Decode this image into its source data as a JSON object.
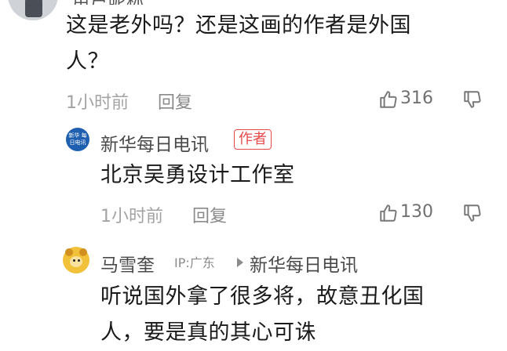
{
  "comments": [
    {
      "text_line1": "这是老外吗？还是这画的作者是外国",
      "text_line2": "人？",
      "time": "1小时前",
      "reply_label": "回复",
      "likes": "316"
    },
    {
      "author": "新华每日电讯",
      "author_tag": "作者",
      "avatar_text": "新华 每日电讯",
      "text": "北京吴勇设计工作室",
      "time": "1小时前",
      "reply_label": "回复",
      "likes": "130"
    },
    {
      "author": "马雪奎",
      "ip": "IP:广东",
      "reply_to": "新华每日电讯",
      "text_line1": "听说国外拿了很多将，故意丑化国",
      "text_line2": "人，要是真的其心可诛"
    }
  ],
  "icons": {
    "like": "thumbs-up-icon",
    "dislike": "thumbs-down-icon",
    "reply_arrow": "triangle-right-icon"
  },
  "colors": {
    "author_tag": "#e64a4a",
    "xinhua_blue": "#1f5fb0"
  }
}
